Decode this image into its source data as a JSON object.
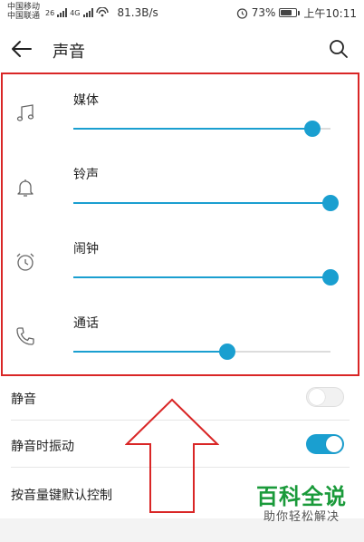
{
  "status_bar": {
    "carrier_1": "中国移动",
    "carrier_2": "中国联通",
    "network_tag_1": "26",
    "network_tag_2": "4G",
    "speed": "81.3B/s",
    "battery_percent": "73%",
    "battery_level": 0.73,
    "time": "上午10:11",
    "icons": [
      "signal-icon",
      "wifi-hotspot-icon",
      "alarm-icon",
      "battery-icon"
    ]
  },
  "app_bar": {
    "title": "声音",
    "back_icon": "arrow-left-icon",
    "search_icon": "search-icon"
  },
  "volume": {
    "items": [
      {
        "label": "媒体",
        "icon": "music-note-icon",
        "level": 0.93
      },
      {
        "label": "铃声",
        "icon": "bell-icon",
        "level": 1.0
      },
      {
        "label": "闹钟",
        "icon": "alarm-clock-icon",
        "level": 1.0
      },
      {
        "label": "通话",
        "icon": "phone-icon",
        "level": 0.6
      }
    ]
  },
  "settings": {
    "items": [
      {
        "label": "静音",
        "toggle": false
      },
      {
        "label": "静音时振动",
        "toggle": true
      },
      {
        "label": "按音量键默认控制"
      }
    ]
  },
  "colors": {
    "accent": "#1a9fd0",
    "annotation_red": "#d92626",
    "watermark_green": "#1a9a3a"
  },
  "watermark": {
    "main": "百科全说",
    "sub": "助你轻松解决"
  }
}
